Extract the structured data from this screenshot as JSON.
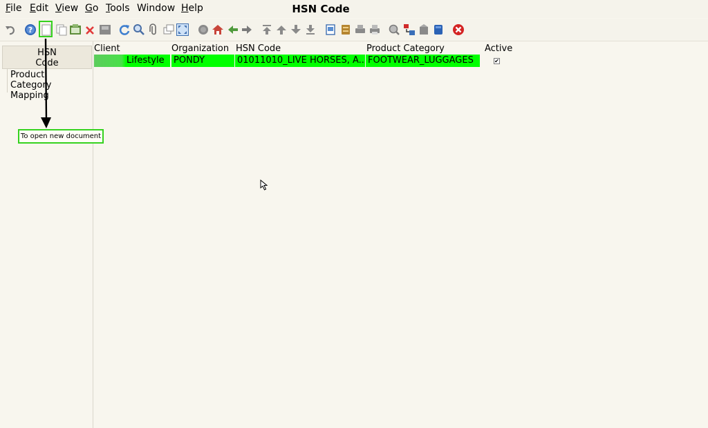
{
  "window": {
    "title": "HSN Code"
  },
  "menu": [
    {
      "mnemonic": "F",
      "rest": "ile"
    },
    {
      "mnemonic": "E",
      "rest": "dit"
    },
    {
      "mnemonic": "V",
      "rest": "iew"
    },
    {
      "mnemonic": "G",
      "rest": "o"
    },
    {
      "mnemonic": "T",
      "rest": "ools"
    },
    {
      "mnemonic": "",
      "rest": "Window"
    },
    {
      "mnemonic": "H",
      "rest": "elp"
    }
  ],
  "toolbar": {
    "icons": [
      "undo-icon",
      "help-icon",
      "new-document-icon",
      "copy-icon",
      "save-icon",
      "delete-icon",
      "save-gray-icon",
      "refresh-icon",
      "find-icon",
      "attachment-icon",
      "multi-window-icon",
      "fullscreen-icon",
      "history-icon",
      "home-icon",
      "back-icon",
      "forward-icon",
      "first-record-icon",
      "previous-record-icon",
      "next-record-icon",
      "last-record-icon",
      "report-icon",
      "archive-icon",
      "print-preview-icon",
      "print-icon",
      "zoom-across-icon",
      "request-icon",
      "product-info-icon",
      "workflow-icon",
      "close-window-icon"
    ]
  },
  "tabs": [
    {
      "label_line1": "HSN",
      "label_line2": "Code"
    },
    {
      "label_line1": "Product",
      "label_line2": "Category Mapping"
    }
  ],
  "annotation": {
    "callout_text": "To open new document"
  },
  "grid": {
    "columns": [
      "Client",
      "Organization",
      "HSN Code",
      "Product Category",
      "Active"
    ],
    "rows": [
      {
        "client": "Lifestyle",
        "organization": "PONDY",
        "hsn_code": "01011010_LIVE HORSES, A...",
        "product_category": "FOOTWEAR_LUGGAGES",
        "active": "✔"
      }
    ]
  },
  "colors": {
    "highlight": "#00ff00",
    "annotation_border": "#35d21e",
    "background": "#f8f6ee"
  }
}
